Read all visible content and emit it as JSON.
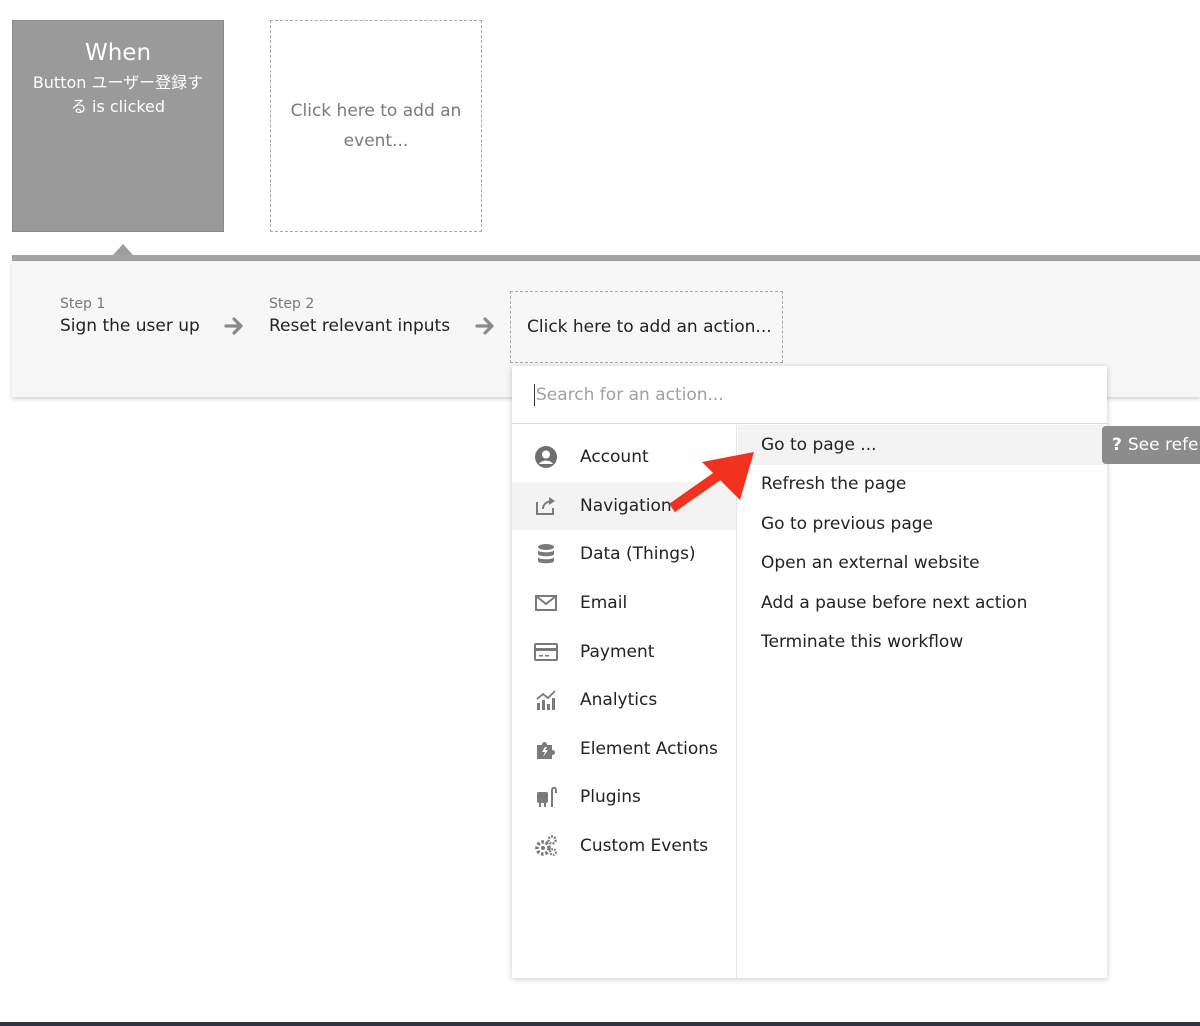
{
  "events": {
    "active": {
      "title": "When",
      "description": "Button ユーザー登録する is clicked"
    },
    "add_placeholder": "Click here to add an event..."
  },
  "steps": [
    {
      "number_label": "Step 1",
      "title": "Sign the user up"
    },
    {
      "number_label": "Step 2",
      "title": "Reset relevant inputs"
    }
  ],
  "add_action_label": "Click here to add an action...",
  "dropdown": {
    "search_placeholder": "Search for an action...",
    "categories": [
      {
        "label": "Account",
        "icon": "account-icon"
      },
      {
        "label": "Navigation",
        "icon": "share-arrow-icon",
        "selected": true
      },
      {
        "label": "Data (Things)",
        "icon": "database-icon"
      },
      {
        "label": "Email",
        "icon": "envelope-icon"
      },
      {
        "label": "Payment",
        "icon": "credit-card-icon"
      },
      {
        "label": "Analytics",
        "icon": "analytics-icon"
      },
      {
        "label": "Element Actions",
        "icon": "puzzle-icon"
      },
      {
        "label": "Plugins",
        "icon": "plug-icon"
      },
      {
        "label": "Custom Events",
        "icon": "gears-icon"
      }
    ],
    "actions": [
      "Go to page ...",
      "Refresh the page",
      "Go to previous page",
      "Open an external website",
      "Add a pause before next action",
      "Terminate this workflow"
    ]
  },
  "tooltip": {
    "icon": "?",
    "label": "See refe"
  },
  "colors": {
    "accent_arrow": "#f0321e",
    "event_active_bg": "#9a9a9a"
  }
}
